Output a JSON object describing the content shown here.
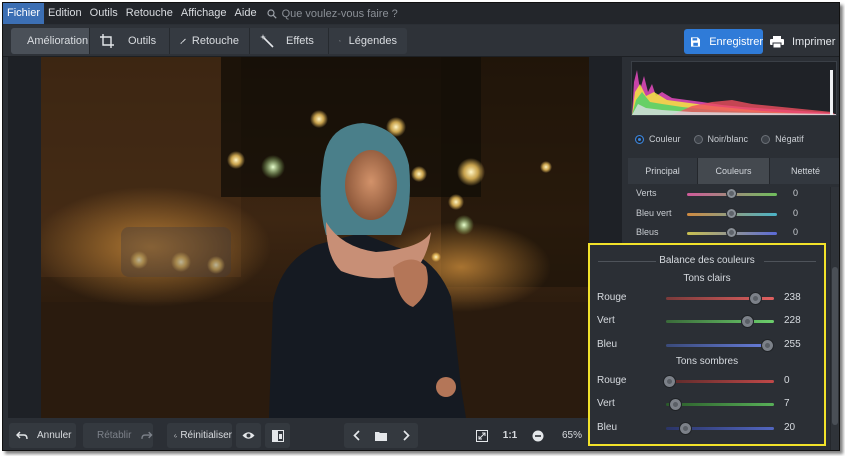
{
  "menu": {
    "items": [
      "Fichier",
      "Edition",
      "Outils",
      "Retouche",
      "Affichage",
      "Aide"
    ],
    "search_placeholder": "Que voulez-vous faire ?"
  },
  "toolbar": {
    "tabs": [
      "Amélioration",
      "Outils",
      "Retouche",
      "Effets",
      "Légendes"
    ],
    "save_label": "Enregistrer",
    "print_label": "Imprimer"
  },
  "bottom": {
    "undo_label": "Annuler",
    "redo_label": "Rétablir",
    "reset_label": "Réinitialiser",
    "ratio_label": "1:1",
    "zoom": "65%"
  },
  "panel": {
    "modes": [
      "Couleur",
      "Noir/blanc",
      "Négatif"
    ],
    "selected_mode": "Couleur",
    "tabs": [
      "Principal",
      "Couleurs",
      "Netteté"
    ],
    "active_tab": "Couleurs",
    "sliders": [
      {
        "label": "Verts",
        "value": "0"
      },
      {
        "label": "Bleu vert",
        "value": "0"
      },
      {
        "label": "Bleus",
        "value": "0"
      }
    ]
  },
  "balance": {
    "title": "Balance des couleurs",
    "highlights_title": "Tons clairs",
    "shadows_title": "Tons sombres",
    "highlights": [
      {
        "label": "Rouge",
        "value": "238"
      },
      {
        "label": "Vert",
        "value": "228"
      },
      {
        "label": "Bleu",
        "value": "255"
      }
    ],
    "shadows": [
      {
        "label": "Rouge",
        "value": "0"
      },
      {
        "label": "Vert",
        "value": "7"
      },
      {
        "label": "Bleu",
        "value": "20"
      }
    ]
  },
  "colors": {
    "accent": "#2f7bd8",
    "highlight_frame": "#f2e22a"
  }
}
